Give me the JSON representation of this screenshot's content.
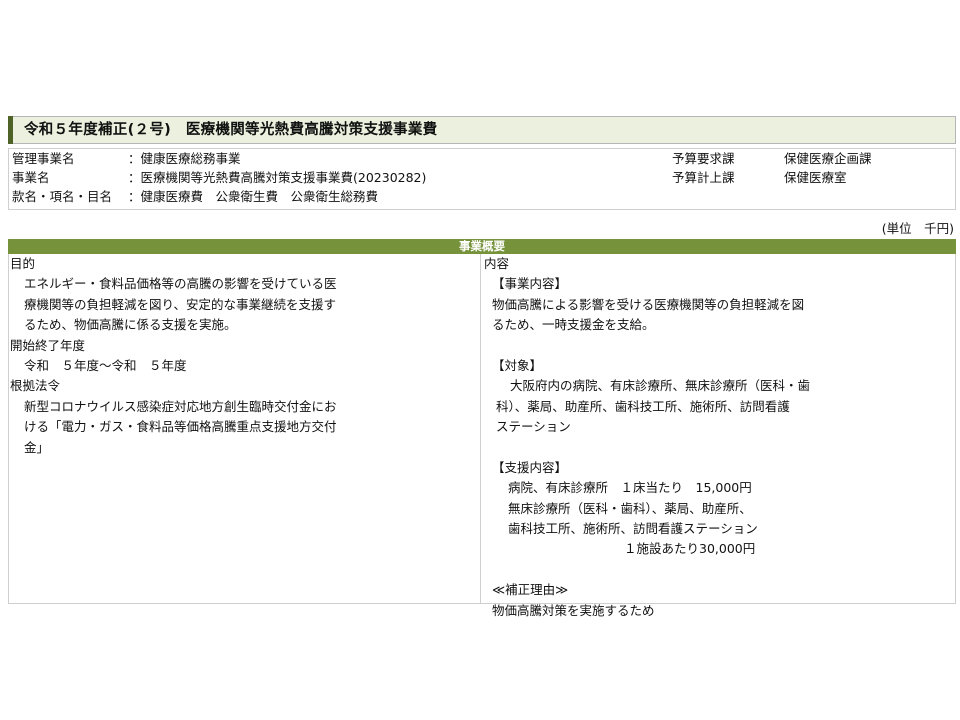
{
  "title": "令和５年度補正(２号)　医療機関等光熱費高騰対策支援事業費",
  "info": {
    "management_label": "管理事業名",
    "management_value": "：健康医療総務事業",
    "project_label": "事業名",
    "project_value": "：医療機関等光熱費高騰対策支援事業費(20230282)",
    "budget_item_label": "款名・項名・目名",
    "budget_item_value": "：健康医療費　公衆衛生費　公衆衛生総務費",
    "request_dept_label": "予算要求課",
    "request_dept_value": "保健医療企画課",
    "account_dept_label": "予算計上課",
    "account_dept_value": "保健医療室"
  },
  "unit_label": "(単位　千円)",
  "section_title": "事業概要",
  "left": {
    "purpose_heading": "目的",
    "purpose_lines": [
      "エネルギー・食料品価格等の高騰の影響を受けている医",
      "療機関等の負担軽減を図り、安定的な事業継続を支援す",
      "るため、物価高騰に係る支援を実施。"
    ],
    "period_heading": "開始終了年度",
    "period_value": "令和　５年度～令和　５年度",
    "law_heading": "根拠法令",
    "law_lines": [
      "新型コロナウイルス感染症対応地方創生臨時交付金にお",
      "ける「電力・ガス・食料品等価格高騰重点支援地方交付",
      "金」"
    ]
  },
  "right": {
    "content_heading": "内容",
    "business_heading": "【事業内容】",
    "business_lines": [
      "物価高騰による影響を受ける医療機関等の負担軽減を図",
      "るため、一時支援金を支給。"
    ],
    "target_heading": "【対象】",
    "target_lines": [
      "大阪府内の病院、有床診療所、無床診療所（医科・歯",
      "科）、薬局、助産所、歯科技工所、施術所、訪問看護",
      "ステーション"
    ],
    "support_heading": "【支援内容】",
    "support_line1": "病院、有床診療所　１床当たり　15,000円",
    "support_line2": "無床診療所（医科・歯科）、薬局、助産所、",
    "support_line3": "歯科技工所、施術所、訪問看護ステーション",
    "support_line4": "１施設あたり30,000円",
    "reason_heading": "≪補正理由≫",
    "reason_text": "物価高騰対策を実施するため"
  }
}
